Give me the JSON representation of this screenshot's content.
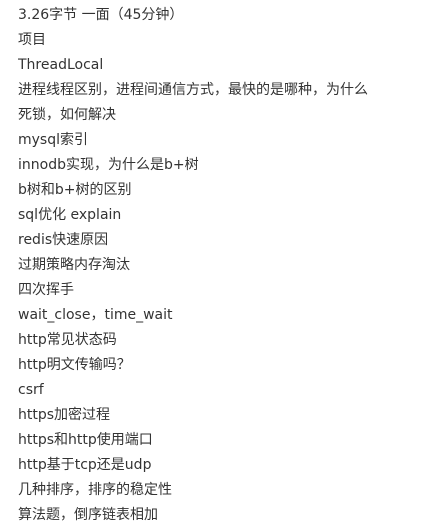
{
  "document": {
    "lines": [
      "3.26字节 一面（45分钟）",
      "项目",
      "ThreadLocal",
      "进程线程区别，进程间通信方式，最快的是哪种，为什么",
      "死锁，如何解决",
      "mysql索引",
      "innodb实现，为什么是b+树",
      "b树和b+树的区别",
      "sql优化 explain",
      "redis快速原因",
      "过期策略内存淘汰",
      "四次挥手",
      "wait_close，time_wait",
      "http常见状态码",
      "http明文传输吗？",
      "csrf",
      "https加密过程",
      "https和http使用端口",
      "http基于tcp还是udp",
      "几种排序，排序的稳定性",
      "算法题，倒序链表相加"
    ]
  }
}
